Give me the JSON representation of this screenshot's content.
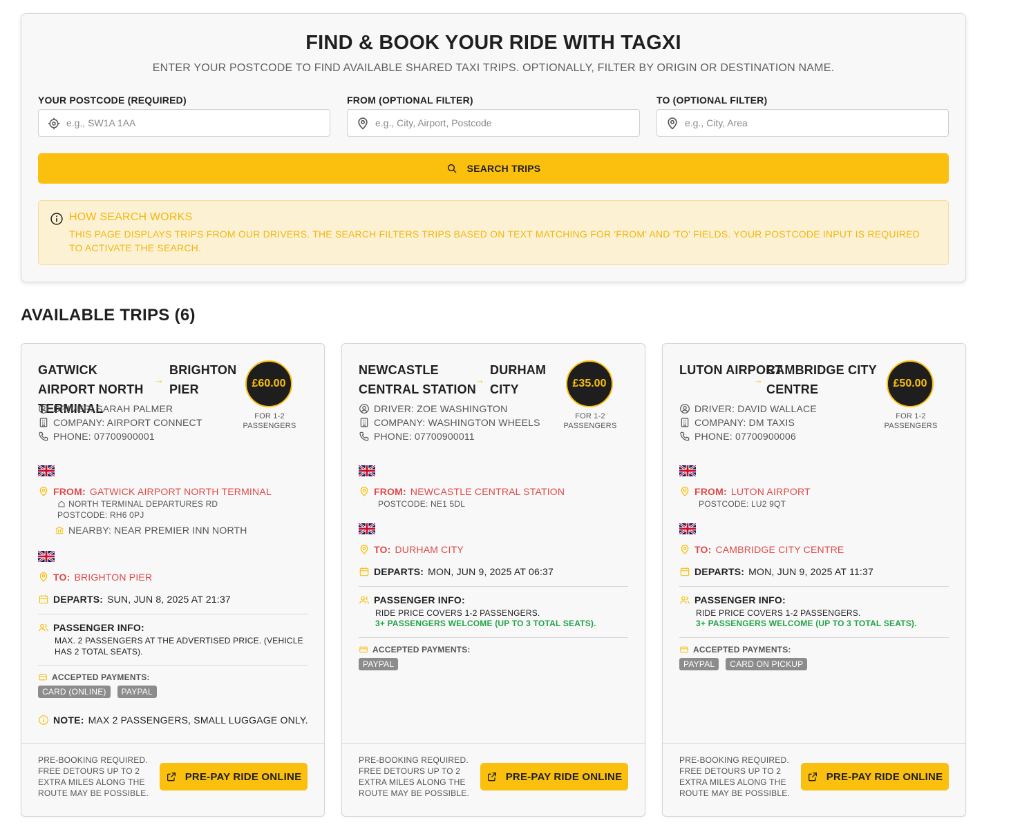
{
  "search": {
    "title": "FIND & BOOK YOUR RIDE WITH TAGXI",
    "subtitle": "ENTER YOUR POSTCODE TO FIND AVAILABLE SHARED TAXI TRIPS. OPTIONALLY, FILTER BY ORIGIN OR DESTINATION NAME.",
    "postcode_label": "YOUR POSTCODE (REQUIRED)",
    "postcode_placeholder": "e.g., SW1A 1AA",
    "from_label": "FROM (OPTIONAL FILTER)",
    "from_placeholder": "e.g., City, Airport, Postcode",
    "to_label": "TO (OPTIONAL FILTER)",
    "to_placeholder": "e.g., City, Area",
    "button_label": "SEARCH TRIPS",
    "info_title": "HOW SEARCH WORKS",
    "info_text": "THIS PAGE DISPLAYS TRIPS FROM OUR DRIVERS. THE SEARCH FILTERS TRIPS BASED ON TEXT MATCHING FOR 'FROM' AND 'TO' FIELDS. YOUR POSTCODE INPUT IS REQUIRED TO ACTIVATE THE SEARCH."
  },
  "trips_heading": "AVAILABLE TRIPS (6)",
  "colors": {
    "accent": "#fbbf0e",
    "location_red": "#e04848",
    "success_green": "#22a447",
    "dark": "#1e1e1e"
  },
  "common": {
    "from_label": "FROM:",
    "to_label": "TO:",
    "departs_label": "DEPARTS:",
    "passenger_info_label": "PASSENGER INFO:",
    "payments_label": "ACCEPTED PAYMENTS:",
    "note_label": "NOTE:",
    "price_note": "FOR 1-2 PASSENGERS",
    "footer_note": "PRE-BOOKING REQUIRED. FREE DETOURS UP TO 2 EXTRA MILES ALONG THE ROUTE MAY BE POSSIBLE.",
    "prepay_label": "PRE-PAY RIDE ONLINE"
  },
  "trips": [
    {
      "route_from": "GATWICK AIRPORT NORTH TERMINAL",
      "route_to": "BRIGHTON PIER",
      "price": "£60.00",
      "driver": "DRIVER: SARAH PALMER",
      "company": "COMPANY: AIRPORT CONNECT",
      "phone": "PHONE: 07700900001",
      "from_value": "GATWICK AIRPORT NORTH TERMINAL",
      "from_address": "NORTH TERMINAL DEPARTURES RD",
      "from_postcode": "POSTCODE: RH6 0PJ",
      "from_nearby": "NEARBY: NEAR PREMIER INN NORTH",
      "to_value": "BRIGHTON PIER",
      "departs": "SUN, JUN 8, 2025 AT 21:37",
      "passenger_text": "MAX. 2 PASSENGERS AT THE ADVERTISED PRICE. (VEHICLE HAS 2 TOTAL SEATS).",
      "payments": [
        "CARD (ONLINE)",
        "PAYPAL"
      ],
      "note": "MAX 2 PASSENGERS, SMALL LUGGAGE ONLY."
    },
    {
      "route_from": "NEWCASTLE CENTRAL STATION",
      "route_to": "DURHAM CITY",
      "price": "£35.00",
      "driver": "DRIVER: ZOE WASHINGTON",
      "company": "COMPANY: WASHINGTON WHEELS",
      "phone": "PHONE: 07700900011",
      "from_value": "NEWCASTLE CENTRAL STATION",
      "from_postcode": "POSTCODE: NE1 5DL",
      "to_value": "DURHAM CITY",
      "departs": "MON, JUN 9, 2025 AT 06:37",
      "passenger_text": "RIDE PRICE COVERS 1-2 PASSENGERS.",
      "passenger_green": "3+ PASSENGERS WELCOME (UP TO 3 TOTAL SEATS).",
      "payments": [
        "PAYPAL"
      ]
    },
    {
      "route_from": "LUTON AIRPORT",
      "route_to": "CAMBRIDGE CITY CENTRE",
      "price": "£50.00",
      "driver": "DRIVER: DAVID WALLACE",
      "company": "COMPANY: DM TAXIS",
      "phone": "PHONE: 07700900006",
      "from_value": "LUTON AIRPORT",
      "from_postcode": "POSTCODE: LU2 9QT",
      "to_value": "CAMBRIDGE CITY CENTRE",
      "departs": "MON, JUN 9, 2025 AT 11:37",
      "passenger_text": "RIDE PRICE COVERS 1-2 PASSENGERS.",
      "passenger_green": "3+ PASSENGERS WELCOME (UP TO 3 TOTAL SEATS).",
      "payments": [
        "PAYPAL",
        "CARD ON PICKUP"
      ]
    }
  ]
}
